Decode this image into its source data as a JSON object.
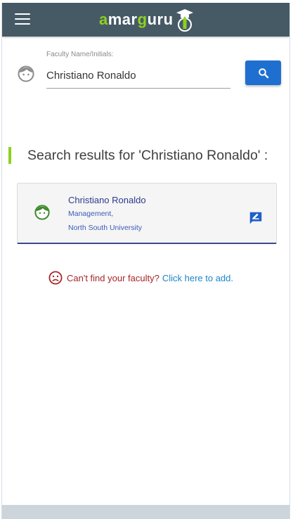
{
  "app": {
    "logo_text_start": "a",
    "logo_text_mid1": "mar",
    "logo_text_g": "g",
    "logo_text_end": "uru",
    "brand_color": "#8ed11f",
    "topbar_color": "#465a66"
  },
  "search": {
    "label": "Faculty Name/Initials:",
    "value": "Christiano Ronaldo",
    "button_icon": "search-icon",
    "button_color": "#1f6fd0"
  },
  "results": {
    "heading": "Search results for 'Christiano Ronaldo' :",
    "items": [
      {
        "name": "Christiano Ronaldo",
        "department": "Management,",
        "university": "North South University",
        "avatar_icon": "face-icon",
        "action_icon": "rate-review-icon"
      }
    ]
  },
  "not_found": {
    "icon": "sad-face-icon",
    "question": "Can't find your faculty?",
    "link": "Click here to add."
  }
}
